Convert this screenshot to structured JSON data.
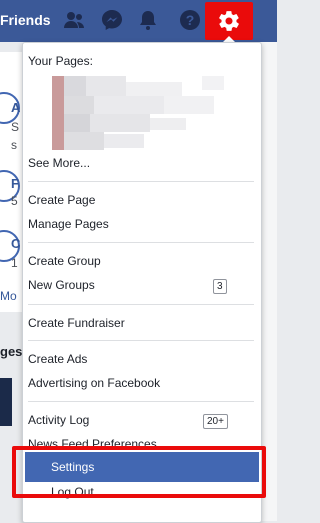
{
  "topbar": {
    "friends_label": "Friends"
  },
  "background": {
    "letters": [
      "A",
      "S",
      "s",
      "F",
      "5",
      "C",
      "1",
      "Mo",
      "ges"
    ]
  },
  "menu": {
    "your_pages_label": "Your Pages:",
    "see_more_label": "See More...",
    "create_page_label": "Create Page",
    "manage_pages_label": "Manage Pages",
    "create_group_label": "Create Group",
    "new_groups_label": "New Groups",
    "new_groups_count": "3",
    "create_fundraiser_label": "Create Fundraiser",
    "create_ads_label": "Create Ads",
    "advertising_label": "Advertising on Facebook",
    "activity_log_label": "Activity Log",
    "activity_log_count": "20+",
    "news_feed_label": "News Feed Preferences",
    "settings_label": "Settings",
    "logout_label": "Log Out"
  },
  "colors": {
    "brand": "#3b5998",
    "highlight": "#4267b2",
    "annotation_red": "#ea0b0b"
  },
  "icons": [
    "friends-icon",
    "messenger-icon",
    "notifications-icon",
    "help-icon",
    "gear-icon"
  ]
}
